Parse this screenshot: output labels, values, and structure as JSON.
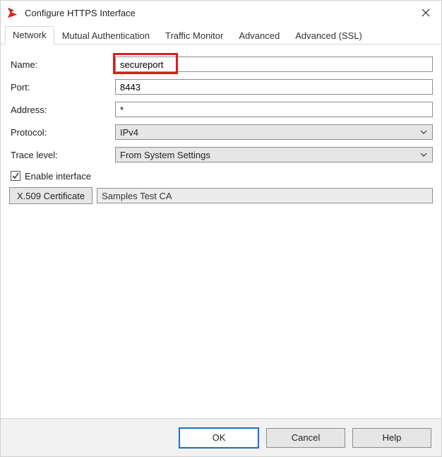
{
  "window": {
    "title": "Configure HTTPS Interface"
  },
  "tabs": [
    {
      "label": "Network",
      "active": true
    },
    {
      "label": "Mutual Authentication",
      "active": false
    },
    {
      "label": "Traffic Monitor",
      "active": false
    },
    {
      "label": "Advanced",
      "active": false
    },
    {
      "label": "Advanced (SSL)",
      "active": false
    }
  ],
  "form": {
    "name": {
      "label": "Name:",
      "value": "secureport"
    },
    "port": {
      "label": "Port:",
      "value": "8443"
    },
    "address": {
      "label": "Address:",
      "value": "*"
    },
    "protocol": {
      "label": "Protocol:",
      "value": "IPv4"
    },
    "trace": {
      "label": "Trace level:",
      "value": "From System Settings"
    },
    "enable": {
      "label": "Enable interface",
      "checked": true
    },
    "cert": {
      "button": "X.509 Certificate",
      "value": "Samples Test CA"
    }
  },
  "buttons": {
    "ok": "OK",
    "cancel": "Cancel",
    "help": "Help"
  }
}
